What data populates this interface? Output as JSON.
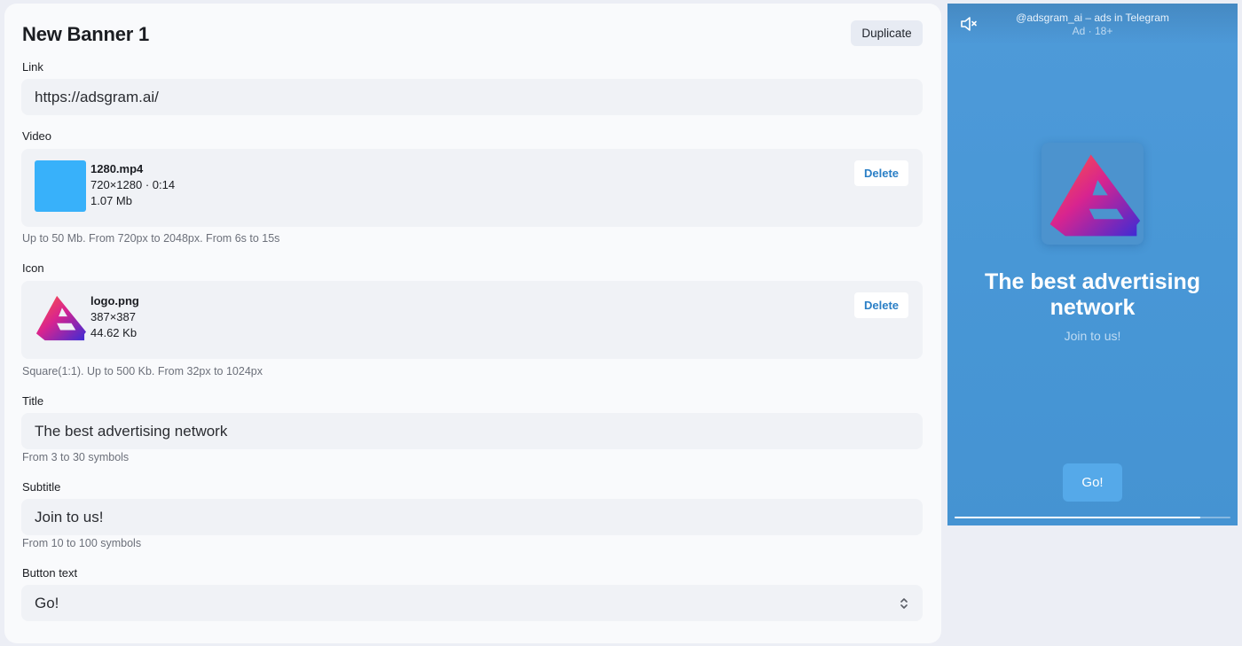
{
  "editor": {
    "title": "New Banner 1",
    "duplicate_label": "Duplicate",
    "link": {
      "label": "Link",
      "value": "https://adsgram.ai/"
    },
    "video": {
      "label": "Video",
      "file_name": "1280.mp4",
      "dimensions_duration": "720×1280 · 0:14",
      "size": "1.07 Mb",
      "delete_label": "Delete",
      "hint": "Up to 50 Mb. From 720px to 2048px. From 6s to 15s",
      "thumb_color": "#38b1fa"
    },
    "icon": {
      "label": "Icon",
      "file_name": "logo.png",
      "dimensions": "387×387",
      "size": "44.62 Kb",
      "delete_label": "Delete",
      "hint": "Square(1:1). Up to 500 Kb. From 32px to 1024px",
      "thumb_icon": "adsgram-logo-icon"
    },
    "title_field": {
      "label": "Title",
      "value": "The best advertising network",
      "hint": "From 3 to 30 symbols"
    },
    "subtitle_field": {
      "label": "Subtitle",
      "value": "Join to us!",
      "hint": "From 10 to 100 symbols"
    },
    "button_text": {
      "label": "Button text",
      "value": "Go!",
      "icon": "chevron-up-down-icon"
    }
  },
  "preview": {
    "mute_icon": "muted-speaker-icon",
    "channel": "@adsgram_ai – ads in Telegram",
    "ad_label": "Ad · 18+",
    "title": "The best advertising network",
    "subtitle": "Join to us!",
    "button": "Go!",
    "progress": 0.89,
    "background": "#4897d6"
  }
}
